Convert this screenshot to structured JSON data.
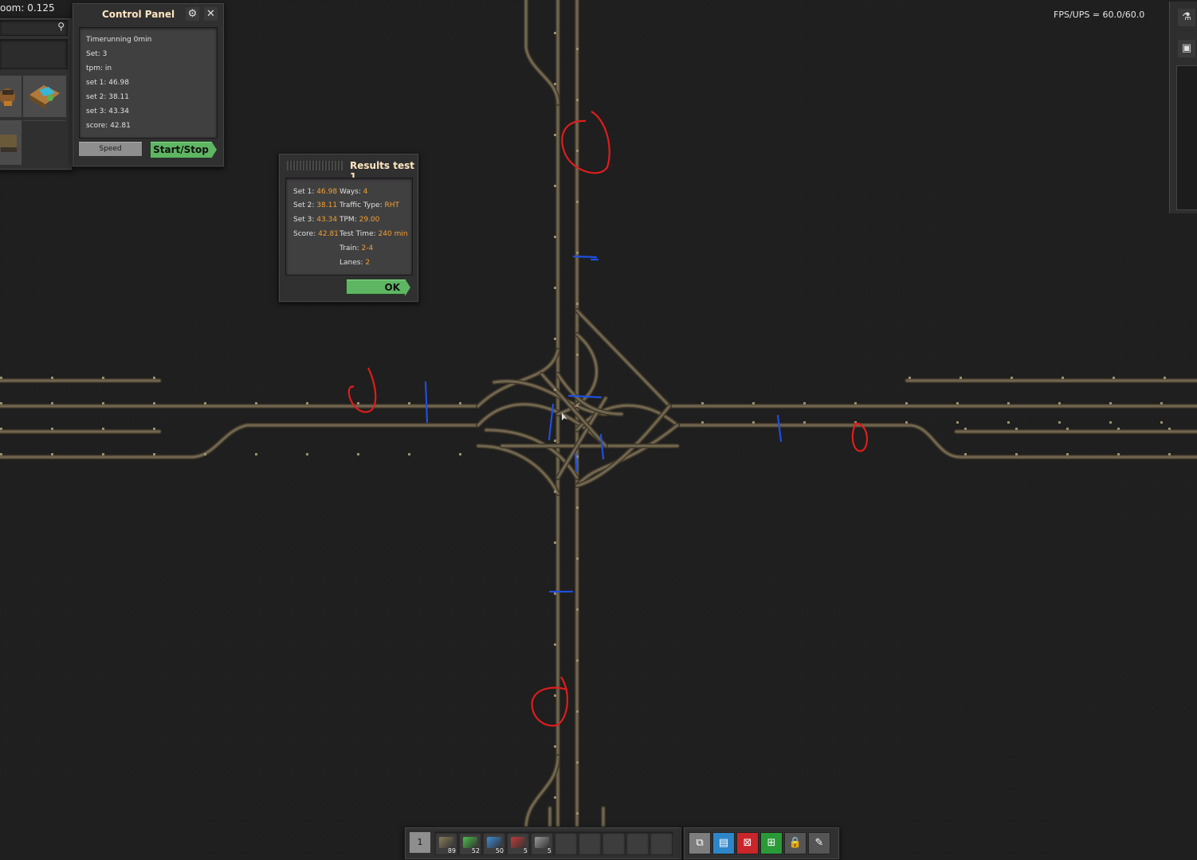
{
  "hud": {
    "zoom_label": "oom: 0.125",
    "fps_label": "FPS/UPS = 60.0/60.0"
  },
  "control_panel": {
    "title": "Control Panel",
    "lines": [
      "Timerunning 0min",
      "Set: 3",
      "tpm: in",
      "set 1: 46.98",
      "set 2: 38.11",
      "set 3: 43.34",
      "score: 42.81"
    ],
    "speed_label": "Speed",
    "start_stop_label": "Start/Stop"
  },
  "results": {
    "title": "Results test 1",
    "set1_label": "Set 1:",
    "set1_value": "46.98",
    "set2_label": "Set 2:",
    "set2_value": "38.11",
    "set3_label": "Set 3:",
    "set3_value": "43.34",
    "score_label": "Score:",
    "score_value": "42.81",
    "ways_label": "Ways:",
    "ways_value": "4",
    "traffic_label": "Traffic Type:",
    "traffic_value": "RHT",
    "tpm_label": "TPM:",
    "tpm_value": "29.00",
    "testtime_label": "Test Time:",
    "testtime_value": "240 min",
    "train_label": "Train:",
    "train_value": "2-4",
    "lanes_label": "Lanes:",
    "lanes_value": "2",
    "ok_label": "OK"
  },
  "quickbar": {
    "page": "1",
    "slots": [
      {
        "icon": "rail-icon",
        "count": "89"
      },
      {
        "icon": "rail-signal-icon",
        "count": "52"
      },
      {
        "icon": "chain-signal-icon",
        "count": "50"
      },
      {
        "icon": "locomotive-icon",
        "count": "5"
      },
      {
        "icon": "cargo-wagon-icon",
        "count": "5"
      },
      {
        "icon": "",
        "count": ""
      },
      {
        "icon": "",
        "count": ""
      },
      {
        "icon": "",
        "count": ""
      },
      {
        "icon": "",
        "count": ""
      },
      {
        "icon": "",
        "count": ""
      }
    ]
  },
  "tools": [
    {
      "icon": "copy-tool-icon",
      "color": "#7d7d7d"
    },
    {
      "icon": "blueprint-book-icon",
      "color": "#2e86c9"
    },
    {
      "icon": "deconstruction-planner-icon",
      "color": "#c8262a"
    },
    {
      "icon": "upgrade-planner-icon",
      "color": "#2a9a37"
    },
    {
      "icon": "lock-icon",
      "color": "#555555"
    },
    {
      "icon": "pipette-icon",
      "color": "#555555"
    }
  ],
  "colors": {
    "rail": "#71664f",
    "rail_dark": "#3e3729",
    "annotation_red": "#e01c1c",
    "annotation_blue": "#1f4fe0",
    "orange_value": "#f0a030",
    "green_button": "#5eb663"
  }
}
